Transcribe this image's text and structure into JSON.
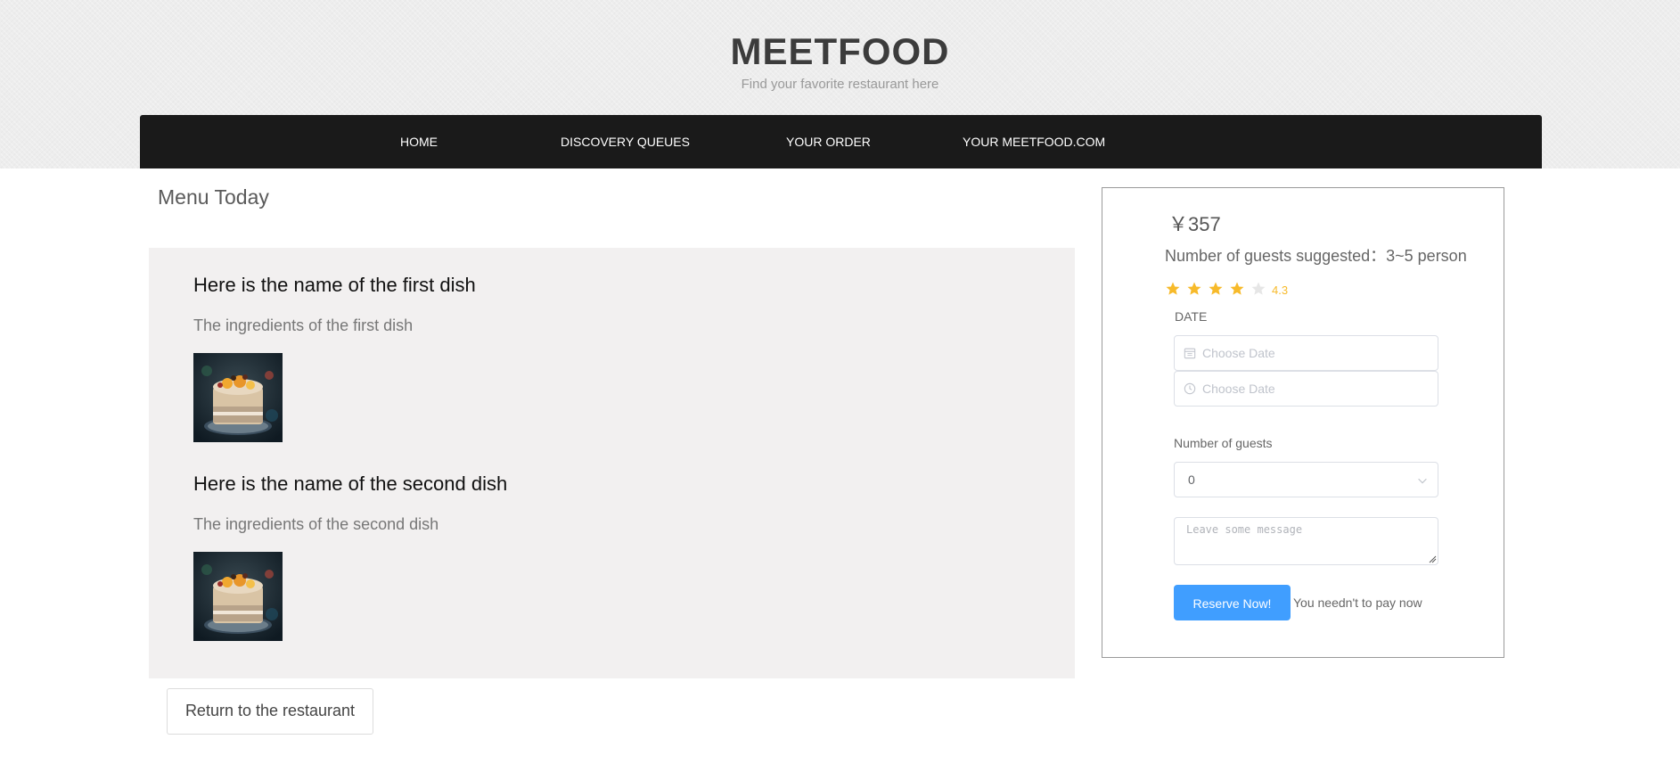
{
  "header": {
    "title": "MEETFOOD",
    "subtitle": "Find your favorite restaurant here"
  },
  "nav": {
    "items": [
      {
        "label": "HOME"
      },
      {
        "label": "DISCOVERY QUEUES"
      },
      {
        "label": "YOUR ORDER"
      },
      {
        "label": "YOUR MEETFOOD.COM"
      }
    ]
  },
  "menu": {
    "heading": "Menu Today",
    "dishes": [
      {
        "name": "Here is the name of the first dish",
        "ingredients": "The ingredients of the first dish",
        "image": "dish-photo"
      },
      {
        "name": "Here is the name of the second dish",
        "ingredients": "The ingredients of the second dish",
        "image": "dish-photo"
      }
    ],
    "return_label": "Return to the restaurant"
  },
  "reservation": {
    "price": "￥357",
    "guests_suggested": "Number of guests suggested：3~5 person",
    "rating": {
      "value": 4.3,
      "max": 5,
      "text": "4.3",
      "color": "#f7ba2a",
      "empty_color": "#e6e6e6"
    },
    "date_label": "DATE",
    "date_placeholder": "Choose Date",
    "time_placeholder": "Choose Date",
    "date_icon": "calendar-icon",
    "time_icon": "clock-icon",
    "guests_label": "Number of guests",
    "guests_value": "0",
    "message_placeholder": "Leave some message",
    "reserve_label": "Reserve Now!",
    "pay_note": "You needn't to pay now"
  },
  "colors": {
    "navbar": "#1a1a1a",
    "primary_button": "#409eff",
    "panel": "#f2f0f0",
    "title": "#3c3c3c"
  }
}
